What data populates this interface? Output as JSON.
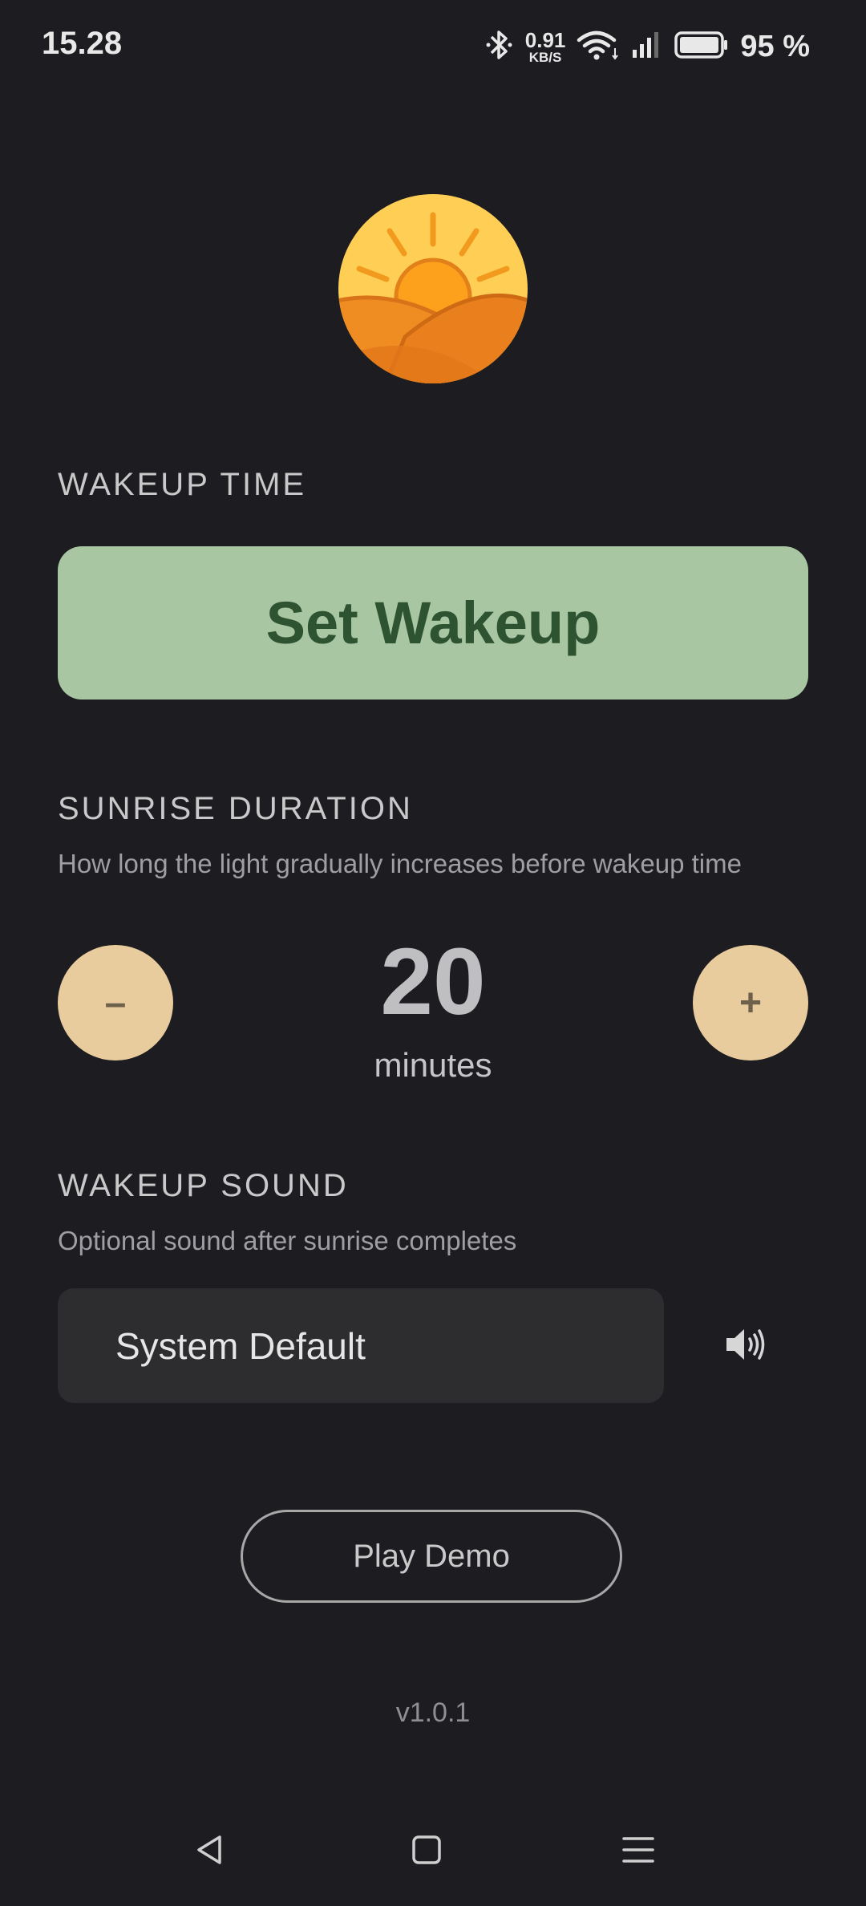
{
  "status_bar": {
    "time": "15.28",
    "net_speed_value": "0.91",
    "net_speed_unit": "KB/S",
    "battery_percent": "95 %",
    "icons": [
      "bluetooth-icon",
      "wifi-icon",
      "signal-icon",
      "battery-icon"
    ]
  },
  "app": {
    "logo": "sunrise-logo-icon"
  },
  "wakeup_time": {
    "label": "WAKEUP TIME",
    "button_label": "Set Wakeup"
  },
  "sunrise_duration": {
    "label": "SUNRISE DURATION",
    "description": "How long the light gradually increases before wakeup time",
    "decrement_label": "–",
    "increment_label": "+",
    "value": "20",
    "unit": "minutes"
  },
  "wakeup_sound": {
    "label": "WAKEUP SOUND",
    "description": "Optional sound after sunrise completes",
    "selected": "System Default",
    "preview_icon": "speaker-icon"
  },
  "play_demo_label": "Play Demo",
  "version": "v1.0.1",
  "nav_bar": {
    "icons": [
      "back-icon",
      "home-icon",
      "menu-icon"
    ]
  },
  "colors": {
    "background": "#1d1c21",
    "wakeup_button": "#a9c6a2",
    "wakeup_button_text": "#2e5330",
    "stepper": "#e9cc9e",
    "sound_select": "#2d2d2f"
  }
}
